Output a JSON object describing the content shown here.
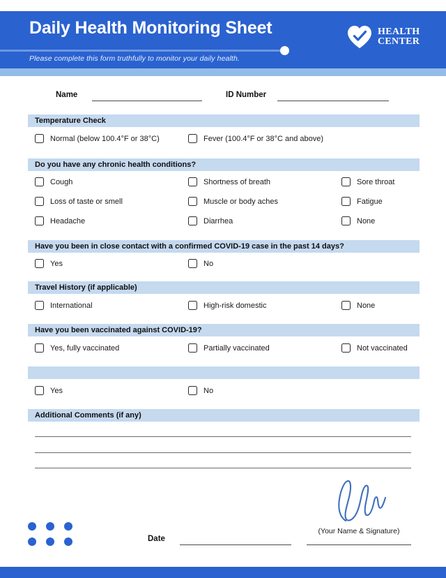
{
  "header": {
    "title": "Daily Health Monitoring Sheet",
    "subtitle": "Please complete this form truthfully to monitor your daily health.",
    "logo_line1": "HEALTH",
    "logo_line2": "CENTER",
    "logo_icon": "heart-check-icon",
    "brand_color": "#2a62d0",
    "accent_color": "#94bce8"
  },
  "identity": {
    "name_label": "Name",
    "name_value": "",
    "id_label": "ID Number",
    "id_value": ""
  },
  "sections": [
    {
      "title": "Temperature Check",
      "options": [
        "Normal (below 100.4°F or 38°C)",
        "Fever (100.4°F or 38°C and above)"
      ]
    },
    {
      "title": "Do you have any chronic health conditions?",
      "options": [
        "Cough",
        "Shortness of breath",
        "Sore throat",
        "Loss of taste or smell",
        "Muscle or body aches",
        "Fatigue",
        "Headache",
        "Diarrhea",
        "None"
      ]
    },
    {
      "title": "Have you been in close contact with a confirmed COVID-19 case in the past 14 days?",
      "options": [
        "Yes",
        "No"
      ]
    },
    {
      "title": "Travel History (if applicable)",
      "options": [
        "International",
        "High-risk domestic",
        "None"
      ]
    },
    {
      "title": "Have you been vaccinated against COVID-19?",
      "options": [
        "Yes, fully vaccinated",
        "Partially vaccinated",
        "Not vaccinated"
      ]
    },
    {
      "title": "",
      "options": [
        "Yes",
        "No"
      ]
    },
    {
      "title": "Additional Comments (if any)",
      "options": []
    }
  ],
  "footer": {
    "date_label": "Date",
    "date_value": "",
    "signature_caption": "(Your Name & Signature)",
    "signature_value": "",
    "dot_color": "#2a62d0"
  }
}
